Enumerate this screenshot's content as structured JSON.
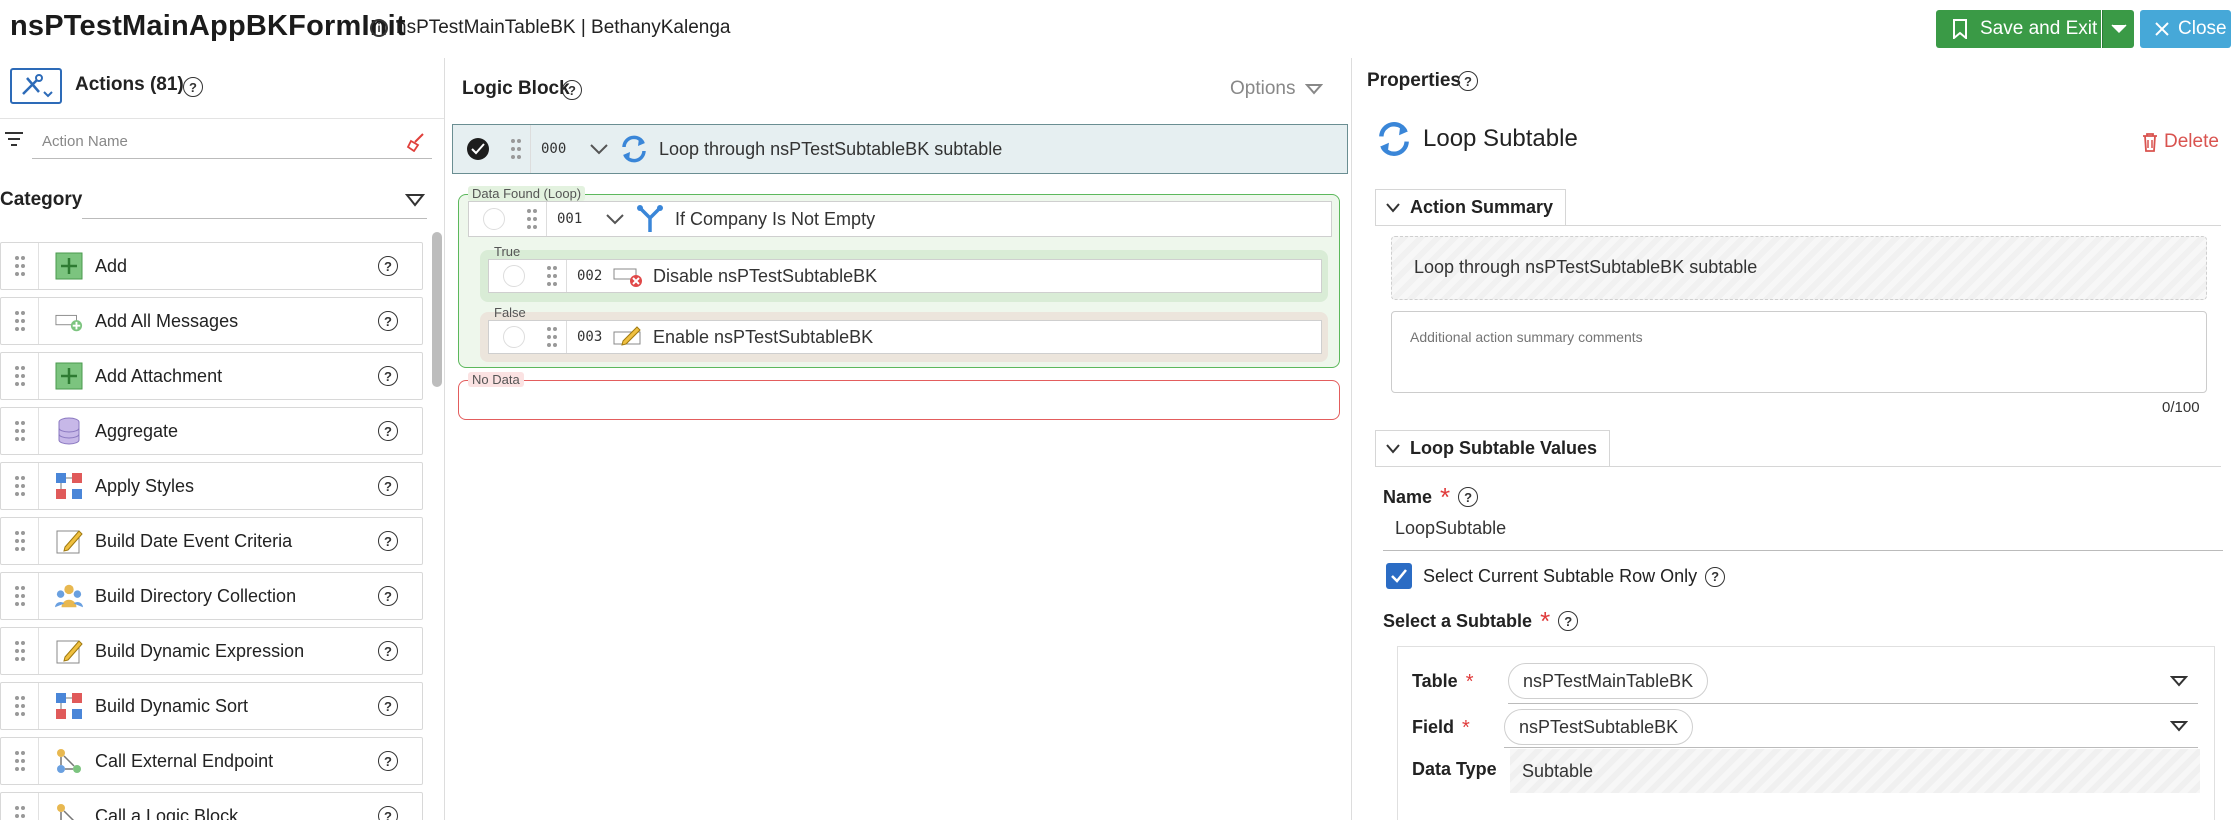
{
  "header": {
    "title": "nsPTestMainAppBKForm​Init",
    "subtitle": "nsPTestMainTableBK | BethanyKalenga",
    "save_label": "Save and Exit",
    "close_label": "Close",
    "colors": {
      "save": "#3a9a46",
      "close": "#46a8d8"
    }
  },
  "actions_panel": {
    "title": "Actions (81)",
    "search_placeholder": "Action Name",
    "category_label": "Category",
    "items": [
      {
        "label": "Add",
        "icon": "plus-icon"
      },
      {
        "label": "Add All Messages",
        "icon": "message-add-icon"
      },
      {
        "label": "Add Attachment",
        "icon": "plus-icon"
      },
      {
        "label": "Aggregate",
        "icon": "database-icon"
      },
      {
        "label": "Apply Styles",
        "icon": "styles-icon"
      },
      {
        "label": "Build Date Event Criteria",
        "icon": "pencil-note-icon"
      },
      {
        "label": "Build Directory Collection",
        "icon": "people-icon"
      },
      {
        "label": "Build Dynamic Expression",
        "icon": "pencil-note-icon"
      },
      {
        "label": "Build Dynamic Sort",
        "icon": "styles-icon"
      },
      {
        "label": "Call External Endpoint",
        "icon": "endpoint-icon"
      },
      {
        "label": "Call a Logic Block",
        "icon": "endpoint-icon"
      }
    ]
  },
  "logic_block": {
    "title": "Logic Block",
    "options_label": "Options",
    "blocks": [
      {
        "num": "000",
        "label": "Loop through nsPTestSubtableBK subtable"
      },
      {
        "num": "001",
        "label": "If Company Is Not Empty"
      },
      {
        "num": "002",
        "label": "Disable nsPTestSubtableBK"
      },
      {
        "num": "003",
        "label": "Enable nsPTestSubtableBK"
      }
    ],
    "containers": {
      "data_found": "Data Found (Loop)",
      "true_label": "True",
      "false_label": "False",
      "no_data": "No Data"
    }
  },
  "properties": {
    "title": "Properties",
    "action_title": "Loop Subtable",
    "delete_label": "Delete",
    "summary_section": "Action Summary",
    "summary_text": "Loop through nsPTestSubtableBK subtable",
    "comments_placeholder": "Additional action summary comments",
    "counter": "0/100",
    "values_section": "Loop Subtable Values",
    "name_label": "Name",
    "name_value": "LoopSubtable",
    "checkbox_label": "Select Current Subtable Row Only",
    "checkbox_checked": true,
    "select_subtable_label": "Select a Subtable",
    "table_label": "Table",
    "table_value": "nsPTestMainTableBK",
    "field_label": "Field",
    "field_value": "nsPTestSubtableBK",
    "datatype_label": "Data Type",
    "datatype_value": "Subtable"
  }
}
